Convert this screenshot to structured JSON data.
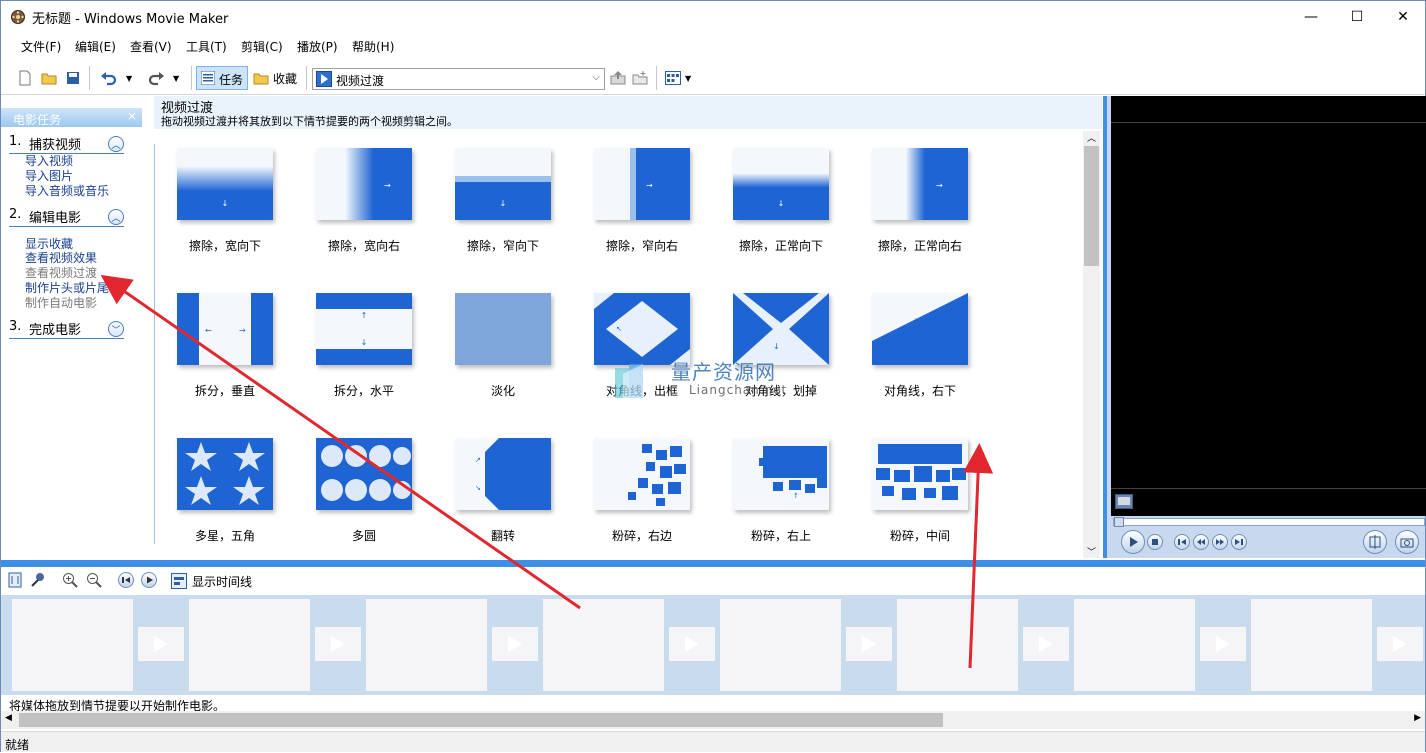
{
  "window": {
    "title": "无标题 - Windows Movie Maker",
    "minimize": "—",
    "maximize": "☐",
    "close": "✕"
  },
  "menu": [
    "文件(F)",
    "编辑(E)",
    "查看(V)",
    "工具(T)",
    "剪辑(C)",
    "播放(P)",
    "帮助(H)"
  ],
  "toolbar": {
    "tasks": "任务",
    "collections": "收藏",
    "combo_value": "视频过渡"
  },
  "left_panel": {
    "header": "电影任务",
    "close": "×",
    "sections": [
      {
        "num": "1.",
        "title": "捕获视频",
        "tasks": [
          "导入视频",
          "导入图片",
          "导入音频或音乐"
        ]
      },
      {
        "num": "2.",
        "title": "编辑电影",
        "tasks": [
          "显示收藏",
          "查看视频效果",
          "查看视频过渡",
          "制作片头或片尾",
          "制作自动电影"
        ]
      },
      {
        "num": "3.",
        "title": "完成电影",
        "tasks": []
      }
    ]
  },
  "content": {
    "title": "视频过渡",
    "description": "拖动视频过渡并将其放到以下情节提要的两个视频剪辑之间。",
    "transitions": [
      {
        "label": "擦除，宽向下",
        "pattern": "wipe-wide-down"
      },
      {
        "label": "擦除，宽向右",
        "pattern": "wipe-wide-right"
      },
      {
        "label": "擦除，窄向下",
        "pattern": "wipe-narrow-down"
      },
      {
        "label": "擦除，窄向右",
        "pattern": "wipe-narrow-right"
      },
      {
        "label": "擦除，正常向下",
        "pattern": "wipe-normal-down"
      },
      {
        "label": "擦除，正常向右",
        "pattern": "wipe-normal-right"
      },
      {
        "label": "拆分，垂直",
        "pattern": "split-vertical"
      },
      {
        "label": "拆分，水平",
        "pattern": "split-horizontal"
      },
      {
        "label": "淡化",
        "pattern": "fade"
      },
      {
        "label": "对角线，出框",
        "pattern": "diagonal-out"
      },
      {
        "label": "对角线，划掉",
        "pattern": "diagonal-cross"
      },
      {
        "label": "对角线，右下",
        "pattern": "diagonal-down-right"
      },
      {
        "label": "多星，五角",
        "pattern": "stars"
      },
      {
        "label": "多圆",
        "pattern": "circles"
      },
      {
        "label": "翻转",
        "pattern": "flip"
      },
      {
        "label": "粉碎，右边",
        "pattern": "shatter-right"
      },
      {
        "label": "粉碎，右上",
        "pattern": "shatter-top-right"
      },
      {
        "label": "粉碎，中间",
        "pattern": "shatter-center"
      }
    ]
  },
  "watermark": {
    "title": "量产资源网",
    "subtitle": "Liangchan.net"
  },
  "storyboard": {
    "show_timeline": "显示时间线",
    "hint": "将媒体拖放到情节提要以开始制作电影。"
  },
  "status": "就绪",
  "colors": {
    "accent": "#3f8fe8",
    "thumb_blue": "#1e64d2",
    "annotation_red": "#e0282e"
  }
}
